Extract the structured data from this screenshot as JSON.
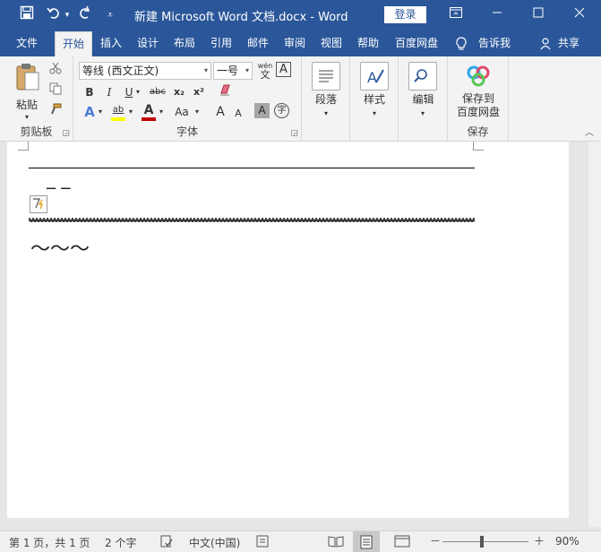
{
  "titlebar": {
    "title": "新建 Microsoft Word 文档.docx  -  Word",
    "login": "登录",
    "save_icon": "save-icon",
    "undo_icon": "undo-icon",
    "redo_icon": "redo-icon",
    "customize_icon": "customize-icon"
  },
  "tabs": [
    {
      "label": "文件"
    },
    {
      "label": "开始"
    },
    {
      "label": "插入"
    },
    {
      "label": "设计"
    },
    {
      "label": "布局"
    },
    {
      "label": "引用"
    },
    {
      "label": "邮件"
    },
    {
      "label": "审阅"
    },
    {
      "label": "视图"
    },
    {
      "label": "帮助"
    },
    {
      "label": "百度网盘"
    },
    {
      "label": "告诉我"
    },
    {
      "label": "共享"
    }
  ],
  "ribbon": {
    "clipboard": {
      "paste": "粘贴",
      "label": "剪贴板"
    },
    "font": {
      "font_name": "等线 (西文正文)",
      "font_size": "一号",
      "wen": "wén",
      "label": "字体",
      "bold": "B",
      "italic": "I",
      "underline": "U",
      "strike": "abc",
      "subscript": "x₂",
      "superscript": "x²",
      "text_effect": "A",
      "highlight": "ab",
      "font_color": "A",
      "change_case": "Aa",
      "grow": "A",
      "shrink": "A",
      "char_shading": "A",
      "enclose": "字",
      "char_border": "A"
    },
    "paragraph": {
      "label": "段落"
    },
    "styles": {
      "label": "样式"
    },
    "editing": {
      "label": "编辑"
    },
    "baidu": {
      "line1": "保存到",
      "line2": "百度网盘",
      "label": "保存"
    }
  },
  "document": {
    "line2_text": "‾ ‾",
    "tilde_text": "～～～"
  },
  "statusbar": {
    "page": "第 1 页，共 1 页",
    "words": "2 个字",
    "lang": "中文(中国)",
    "zoom": "90%",
    "minus": "－",
    "plus": "＋"
  },
  "colors": {
    "brand": "#2b579a",
    "ribbon_bg": "#f3f3f3",
    "font_color_bar": "#c00000",
    "highlight_bar": "#ffff00"
  }
}
